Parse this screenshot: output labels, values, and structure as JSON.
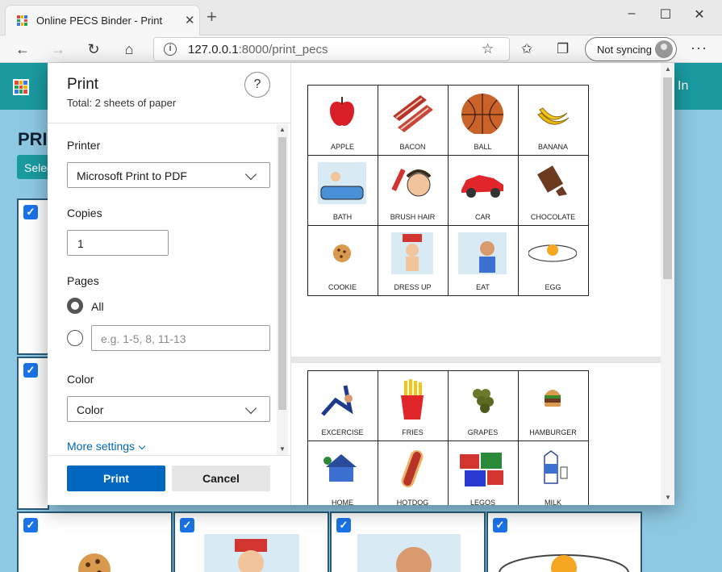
{
  "browser": {
    "tab_title": "Online PECS Binder - Print",
    "url_host": "127.0.0.1",
    "url_path": ":8000/print_pecs",
    "sync_label": "Not syncing",
    "icons": [
      "back-arrow-icon",
      "forward-arrow-icon",
      "refresh-icon",
      "home-icon",
      "info-icon",
      "add-favorite-icon",
      "favorites-icon",
      "collections-icon",
      "more-icon"
    ]
  },
  "page": {
    "title": "PRI",
    "select_button": "Selec",
    "login_text": "In"
  },
  "print_dialog": {
    "title": "Print",
    "subtitle": "Total: 2 sheets of paper",
    "help_label": "?",
    "printer": {
      "label": "Printer",
      "value": "Microsoft Print to PDF"
    },
    "copies": {
      "label": "Copies",
      "value": "1"
    },
    "pages": {
      "label": "Pages",
      "all_label": "All",
      "range_placeholder": "e.g. 1-5, 8, 11-13",
      "selected": "All"
    },
    "color": {
      "label": "Color",
      "value": "Color"
    },
    "more_settings": "More settings",
    "print_button": "Print",
    "cancel_button": "Cancel"
  },
  "preview": {
    "sheets": [
      {
        "cards": [
          "APPLE",
          "BACON",
          "BALL",
          "BANANA",
          "BATH",
          "BRUSH HAIR",
          "CAR",
          "CHOCOLATE",
          "COOKIE",
          "DRESS UP",
          "EAT",
          "EGG"
        ]
      },
      {
        "cards": [
          "EXCERCISE",
          "FRIES",
          "GRAPES",
          "HAMBURGER",
          "HOME",
          "HOTDOG",
          "LEGOS",
          "MILK"
        ]
      }
    ]
  },
  "colors": {
    "header_teal": "#1a9aa0",
    "page_bg": "#8ec9e3",
    "print_blue": "#0067c0",
    "link_blue": "#0067b8",
    "checkbox_blue": "#1a73e8"
  }
}
